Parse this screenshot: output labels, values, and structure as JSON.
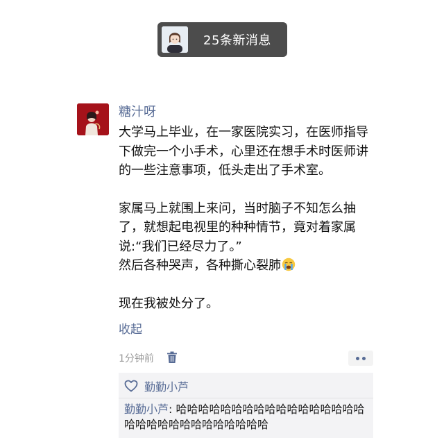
{
  "notification": {
    "text": "25条新消息",
    "avatar_icon": "cartoon-avatar-icon"
  },
  "post": {
    "avatar_icon": "red-illustration-avatar",
    "nickname": "糖汁呀",
    "paragraphs": [
      "大学马上毕业，在一家医院实习，在医师指导下做完一个小手术，心里还在想手术时医师讲的一些注意事项，低头走出了手术室。",
      "家属马上就围上来问，当时脑子不知怎么抽了，就想起电视里的种种情节，竟对着家属说:“我们已经尽力了。”",
      "然后各种哭声，各种撕心裂肺",
      "现在我被处分了。"
    ],
    "emoji": "crying-face-emoji",
    "collapse_label": "收起",
    "time": "1分钟前",
    "likes": [
      "勤勤小芦"
    ],
    "comments": [
      {
        "author": "勤勤小芦",
        "separator": ": ",
        "text": "哈哈哈哈哈哈哈哈哈哈哈哈哈哈哈哈哈哈哈哈哈哈哈哈哈哈哈哈哈哈"
      }
    ]
  },
  "colors": {
    "link": "#576b95",
    "pill_bg": "#4c4c4c",
    "comment_bg": "#f3f3f5"
  }
}
